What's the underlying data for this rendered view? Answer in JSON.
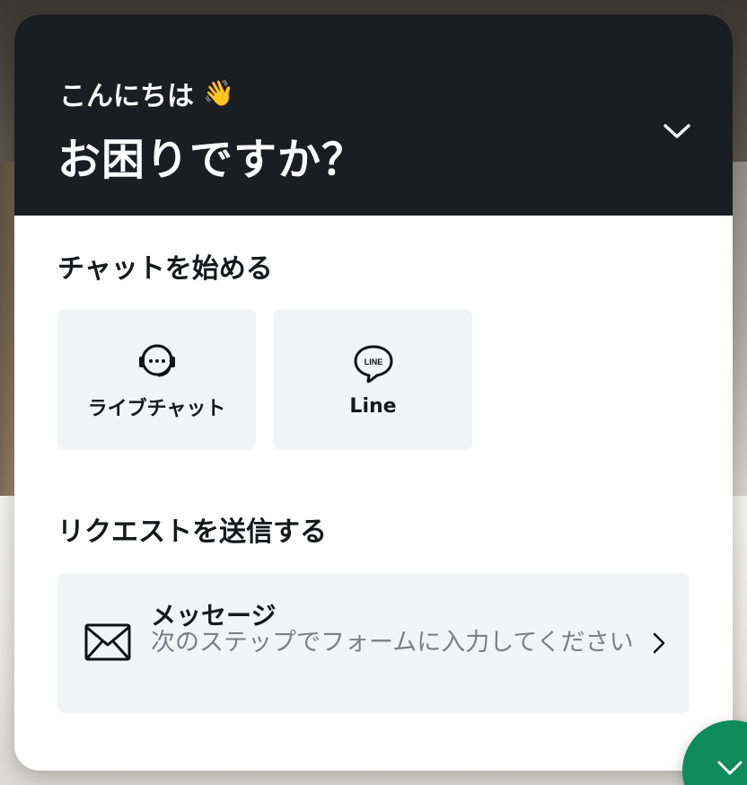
{
  "header": {
    "greeting": "こんにちは",
    "wave_emoji": "👋",
    "headline": "お困りですか？"
  },
  "chat_section": {
    "title": "チャットを始める",
    "channels": [
      {
        "label": "ライブチャット",
        "icon": "livechat-headset-icon"
      },
      {
        "label": "Line",
        "icon": "line-app-icon"
      }
    ]
  },
  "request_section": {
    "title": "リクエストを送信する",
    "message": {
      "title": "メッセージ",
      "description": "次のステップでフォームに入力してください",
      "icon": "envelope-icon"
    }
  },
  "colors": {
    "header_bg": "#1a1d21",
    "card_bg": "#f3f4f6",
    "launcher_bg": "#0e8a5f"
  }
}
